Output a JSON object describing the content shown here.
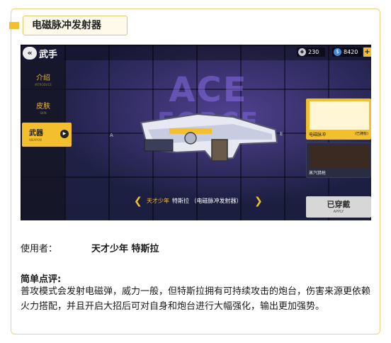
{
  "header": {
    "title": "电磁脉冲发射器"
  },
  "game": {
    "page_title": "武手",
    "resources": {
      "gems": "230",
      "coins": "8420",
      "add": "+"
    },
    "sidebar": [
      {
        "label": "介绍",
        "sub": "INTRODUCE"
      },
      {
        "label": "皮肤",
        "sub": "SKIN"
      },
      {
        "label": "武器",
        "sub": "WEAPON",
        "active": true
      }
    ],
    "banner_line1": "ACE",
    "banner_line2": "FORCE",
    "markers": [
      "A",
      "B",
      "E",
      "A"
    ],
    "selector": {
      "hero": "天才少年",
      "weapon": "特斯拉 （电磁脉冲发射器）"
    },
    "weapons": [
      {
        "name": "电磁脉冲",
        "tag": "(已拥有)"
      },
      {
        "name": "蒸汽猎枪",
        "tag": ""
      }
    ],
    "equip": {
      "label": "已穿戴",
      "sub": "APPLY"
    },
    "colors": {
      "accent": "#f3bf2c",
      "background": "#1a1e3c"
    }
  },
  "user": {
    "label": "使用者：",
    "name": "天才少年 特斯拉"
  },
  "review": {
    "title": "简单点评:",
    "body": "普攻模式会发射电磁弹，威力一般，但特斯拉拥有可持续攻击的炮台，伤害来源更依赖火力搭配，并且开启大招后可对自身和炮台进行大幅强化，输出更加强势。"
  }
}
